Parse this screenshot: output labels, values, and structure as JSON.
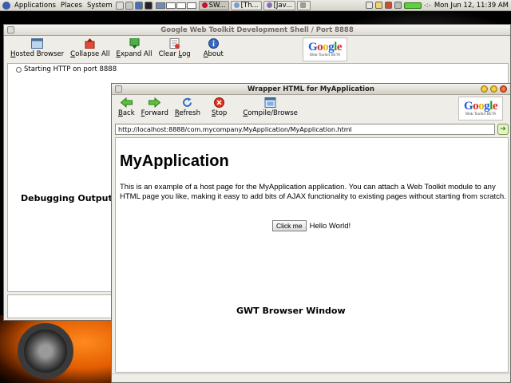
{
  "top_panel": {
    "menus": [
      "Applications",
      "Places",
      "System"
    ],
    "tasks": [
      {
        "label": "SW...",
        "icon": "red-record-icon",
        "color": "#c8102e"
      },
      {
        "label": "[Th...",
        "icon": "browser-icon",
        "color": "#7f9dc6"
      },
      {
        "label": "[Jav...",
        "icon": "java-icon",
        "color": "#8a6fb3"
      },
      {
        "label": "",
        "icon": "window-icon",
        "color": "#9e9b94"
      }
    ],
    "tray_text": "-:-",
    "clock": "Mon Jun 12, 11:39 AM"
  },
  "shell": {
    "title": "Google Web Toolkit Development Shell / Port 8888",
    "toolbar": {
      "hosted_prefix": "H",
      "hosted_rest": "osted Browser",
      "collapse_prefix": "C",
      "collapse_rest": "ollapse All",
      "expand_prefix": "E",
      "expand_rest": "xpand All",
      "clear_pre": "Clear ",
      "clear_u": "L",
      "clear_rest": "og",
      "about_prefix": "A",
      "about_rest": "bout"
    },
    "log_entry": "Starting HTTP on port 8888",
    "debug_label": "Debugging Output"
  },
  "google_logo": {
    "word": "Google",
    "sub": "Web Toolkit BETA"
  },
  "browser": {
    "title": "Wrapper HTML for MyApplication",
    "toolbar": {
      "back_prefix": "B",
      "back_rest": "ack",
      "forward_prefix": "F",
      "forward_rest": "orward",
      "refresh_prefix": "R",
      "refresh_rest": "efresh",
      "stop_prefix": "S",
      "stop_rest": "top",
      "compile_prefix": "C",
      "compile_rest": "ompile/Browse"
    },
    "url": "http://localhost:8888/com.mycompany.MyApplication/MyApplication.html",
    "page": {
      "heading": "MyApplication",
      "description": "This is an example of a host page for the MyApplication application. You can attach a Web Toolkit module to any HTML page you like, making it easy to add bits of AJAX functionality to existing pages without starting from scratch.",
      "button": "Click me",
      "output": "Hello World!"
    },
    "window_label": "GWT Browser Window"
  }
}
